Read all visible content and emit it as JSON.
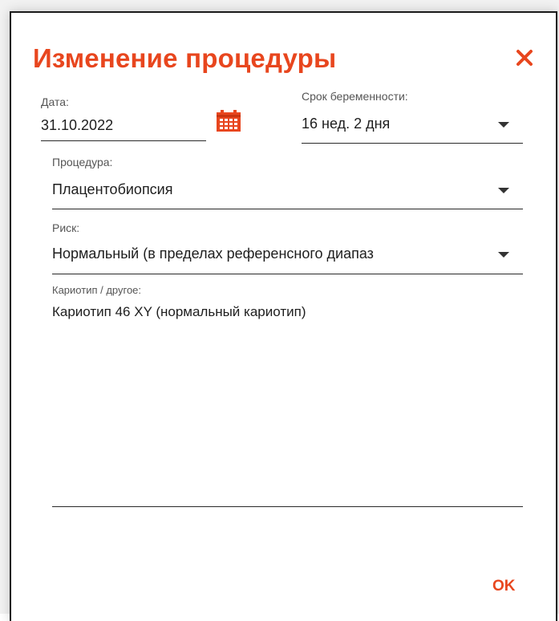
{
  "dialog": {
    "title": "Изменение процедуры",
    "ok_label": "OK",
    "accent_color": "#e8461e"
  },
  "fields": {
    "date": {
      "label": "Дата:",
      "value": "31.10.2022",
      "icon": "calendar-icon"
    },
    "gestation": {
      "label": "Срок беременности:",
      "value": "16 нед. 2 дня"
    },
    "procedure": {
      "label": "Процедура:",
      "value": "Плацентобиопсия"
    },
    "risk": {
      "label": "Риск:",
      "value": "Нормальный (в пределах референсного диапаз"
    },
    "karyotype": {
      "label": "Кариотип / другое:",
      "value": "Кариотип 46 XY (нормальный кариотип)"
    }
  },
  "icons": {
    "close": "close-icon",
    "dropdown": "chevron-down-icon"
  }
}
